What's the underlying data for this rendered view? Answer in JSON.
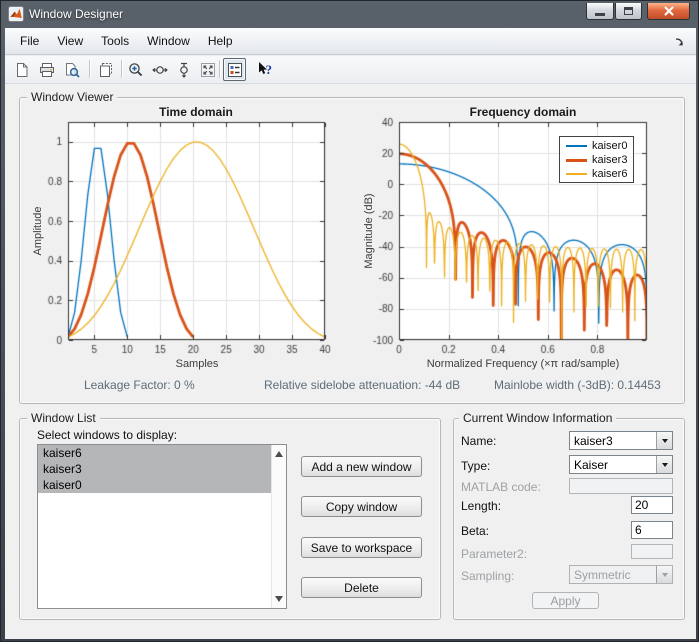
{
  "window": {
    "title": "Window Designer",
    "controls": {
      "minimize": "minimize",
      "maximize": "maximize",
      "close": "close"
    }
  },
  "menu": {
    "items": [
      "File",
      "View",
      "Tools",
      "Window",
      "Help"
    ]
  },
  "toolbar": {
    "buttons": [
      "new-figure",
      "print",
      "print-preview",
      "copy-figure",
      "zoom-in",
      "zoom-x",
      "zoom-y",
      "restore-view",
      "toggle-legend",
      "context-help"
    ],
    "toggled": "toggle-legend"
  },
  "viewer": {
    "label": "Window Viewer",
    "status": {
      "leakage": "Leakage Factor: 0 %",
      "sidelobe": "Relative sidelobe attenuation: -44 dB",
      "mainlobe": "Mainlobe width (-3dB): 0.14453"
    }
  },
  "chart_data": [
    {
      "type": "line",
      "mode": "time",
      "title": "Time domain",
      "xlabel": "Samples",
      "ylabel": "Amplitude",
      "xlim": [
        1,
        40
      ],
      "ylim": [
        0,
        1.1
      ],
      "xticks": [
        5,
        10,
        15,
        20,
        25,
        30,
        35,
        40
      ],
      "yticks": [
        0,
        0.2,
        0.4,
        0.6,
        0.8,
        1
      ],
      "grid": true,
      "box": true,
      "series": [
        {
          "name": "kaiser0",
          "color": "#0072BD",
          "line_width": 1.3,
          "window": {
            "type": "kaiser",
            "length": 10,
            "beta": 6
          }
        },
        {
          "name": "kaiser3",
          "color": "#D95319",
          "line_width": 2.8,
          "window": {
            "type": "kaiser",
            "length": 20,
            "beta": 6
          }
        },
        {
          "name": "kaiser6",
          "color": "#EDB120",
          "line_width": 1.3,
          "window": {
            "type": "kaiser",
            "length": 40,
            "beta": 6
          }
        }
      ]
    },
    {
      "type": "line",
      "mode": "frequency",
      "title": "Frequency domain",
      "xlabel": "Normalized Frequency  (×π rad/sample)",
      "ylabel": "Magnitude (dB)",
      "xlim": [
        0,
        1
      ],
      "ylim": [
        -100,
        40
      ],
      "xticks": [
        0,
        0.2,
        0.4,
        0.6,
        0.8
      ],
      "yticks": [
        -100,
        -80,
        -60,
        -40,
        -20,
        0,
        20,
        40
      ],
      "grid": true,
      "box": true,
      "legend_position": "northeast",
      "series": [
        {
          "name": "kaiser0",
          "color": "#0072BD",
          "line_width": 1.3,
          "window": {
            "type": "kaiser",
            "length": 10,
            "beta": 6
          }
        },
        {
          "name": "kaiser3",
          "color": "#D95319",
          "line_width": 2.8,
          "window": {
            "type": "kaiser",
            "length": 20,
            "beta": 6
          }
        },
        {
          "name": "kaiser6",
          "color": "#EDB120",
          "line_width": 1.3,
          "window": {
            "type": "kaiser",
            "length": 40,
            "beta": 6
          }
        }
      ]
    }
  ],
  "window_list": {
    "label": "Window List",
    "prompt": "Select windows to display:",
    "items": [
      {
        "name": "kaiser6",
        "selected": true
      },
      {
        "name": "kaiser3",
        "selected": true
      },
      {
        "name": "kaiser0",
        "selected": true
      }
    ],
    "buttons": [
      "Add a new window",
      "Copy window",
      "Save to workspace",
      "Delete"
    ]
  },
  "current_window": {
    "label": "Current Window Information",
    "name": {
      "label": "Name:",
      "value": "kaiser3",
      "enabled": true
    },
    "type": {
      "label": "Type:",
      "value": "Kaiser",
      "enabled": true
    },
    "matlab_code": {
      "label": "MATLAB code:",
      "value": "",
      "enabled": false
    },
    "length": {
      "label": "Length:",
      "value": "20",
      "enabled": true
    },
    "beta": {
      "label": "Beta:",
      "value": "6",
      "enabled": true
    },
    "parameter2": {
      "label": "Parameter2:",
      "value": "",
      "enabled": false
    },
    "sampling": {
      "label": "Sampling:",
      "value": "Symmetric",
      "enabled": false
    },
    "apply": {
      "label": "Apply",
      "enabled": false
    }
  },
  "colors": {
    "accent_blue": "#0072BD",
    "accent_orange": "#D95319",
    "accent_yellow": "#EDB120",
    "selection_gray": "#b4b6b8",
    "status_text": "#5e6c78"
  }
}
